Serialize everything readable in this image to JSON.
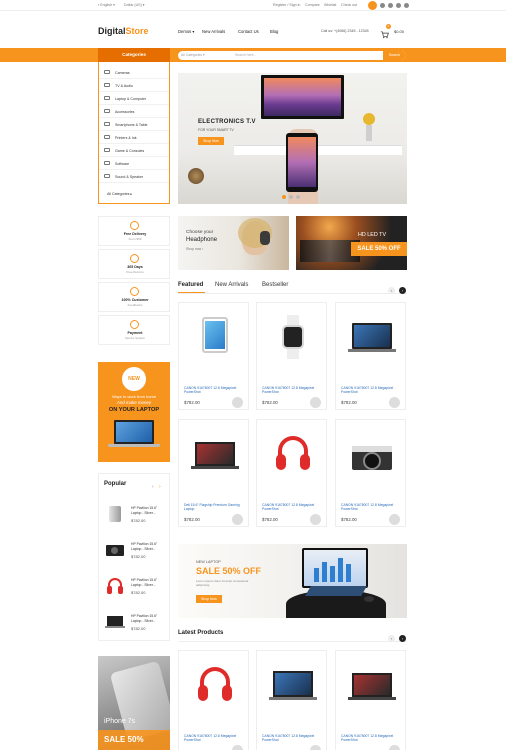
{
  "topbar": {
    "language": "English",
    "currency": "Dollar (US)",
    "register": "Register / Sign in",
    "compare": "Compare",
    "wishlist": "Wishlist",
    "checkout": "Check out"
  },
  "header": {
    "logo_a": "Digital",
    "logo_b": "Store",
    "nav": [
      "Demos",
      "New Arrivals",
      "Contact Us",
      "Blog"
    ],
    "phone": "Call us: +(4066) 2345 - 12345",
    "cart_count": "0",
    "cart_total": "$0.00"
  },
  "catbar": {
    "title": "Categories",
    "select": "All Categories",
    "placeholder": "Search here...",
    "search_btn": "Search"
  },
  "categories": [
    "Cameras",
    "TV & Audio",
    "Laptop & Computer",
    "Accessories",
    "Smartphone & Table",
    "Printers & Ink",
    "Game & Consoles",
    "Software",
    "Sound & Speaker"
  ],
  "all_categories": "All Categories",
  "hero": {
    "title": "ELECTRONICS T.V",
    "subtitle": "FOR YOUR SMART TV",
    "button": "Shop Now"
  },
  "features": [
    {
      "title": "Free Delivery",
      "sub": "From $59"
    },
    {
      "title": "365 Days",
      "sub": "Free Returns"
    },
    {
      "title": "100% Customer",
      "sub": "Feedbacks"
    },
    {
      "title": "Payment",
      "sub": "Secure System"
    }
  ],
  "promo": {
    "badge": "NEW",
    "line1": "Ways to work from home",
    "line2": "And make money",
    "line3": "ON YOUR LAPTOP"
  },
  "popular": {
    "title": "Popular",
    "items": [
      {
        "name": "HP Pavilion 15.6\" Laptop - Silver...",
        "price": "$782.00"
      },
      {
        "name": "HP Pavilion 15.6\" Laptop - Silver...",
        "price": "$782.00"
      },
      {
        "name": "HP Pavilion 15.6\" Laptop - Silver...",
        "price": "$782.00"
      },
      {
        "name": "HP Pavilion 15.6\" Laptop - Silver...",
        "price": "$782.00"
      }
    ]
  },
  "iphone": {
    "model": "iPhone 7s",
    "sale": "SALE 50%"
  },
  "banner_headphone": {
    "line1": "Choose your",
    "line2": "Headphone",
    "link": "Shop now"
  },
  "banner_tv": {
    "title": "HD LED TV",
    "sale": "SALE 50% OFF"
  },
  "tabs": [
    "Featured",
    "New Arrivals",
    "Bestseller"
  ],
  "products": [
    {
      "name": "CANON 91678007 12.8 Megapixel PowerShot",
      "price": "$782.00",
      "kind": "tablet-icon"
    },
    {
      "name": "CANON 91678007 12.8 Megapixel PowerShot",
      "price": "$782.00",
      "kind": "watch-icon"
    },
    {
      "name": "CANON 91678007 12.8 Megapixel PowerShot",
      "price": "$782.00",
      "kind": "laptop-icon"
    },
    {
      "name": "Dell 15.6\" Flagship Premium Gaming Laptop",
      "price": "$782.00",
      "kind": "laptop-icon"
    },
    {
      "name": "CANON 91678007 12.8 Megapixel PowerShot",
      "price": "$782.00",
      "kind": "headphone-icon"
    },
    {
      "name": "CANON 91678007 12.8 Megapixel PowerShot",
      "price": "$782.00",
      "kind": "camera-icon"
    }
  ],
  "big_banner": {
    "kicker": "NEW LAPTOP",
    "sale": "SALE 50% OFF",
    "desc": "Lorem ipsum dolor sit amet consectetur adipiscing",
    "button": "Shop Now"
  },
  "latest": {
    "title": "Latest Products",
    "items": [
      {
        "name": "CANON 91678007 12.8 Megapixel PowerShot",
        "kind": "headphone-icon"
      },
      {
        "name": "CANON 91678007 12.8 Megapixel PowerShot",
        "kind": "laptop-icon"
      },
      {
        "name": "CANON 91678007 12.8 Megapixel PowerShot",
        "kind": "laptop-icon"
      }
    ]
  },
  "colors": {
    "accent": "#f7941d",
    "accent_dark": "#e66e00",
    "link": "#2a6bb7"
  }
}
